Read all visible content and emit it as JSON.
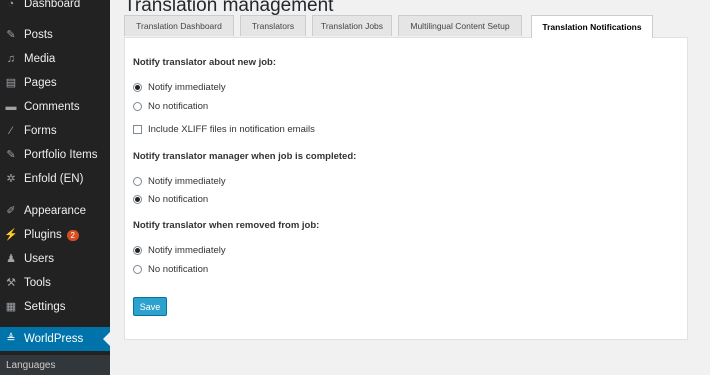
{
  "sidebar": {
    "items": [
      {
        "label": "Dashboard",
        "icon": "dashboard-icon"
      },
      {
        "label": "Posts",
        "icon": "pin-icon"
      },
      {
        "label": "Media",
        "icon": "media-icon"
      },
      {
        "label": "Pages",
        "icon": "pages-icon"
      },
      {
        "label": "Comments",
        "icon": "comments-icon"
      },
      {
        "label": "Forms",
        "icon": "forms-icon"
      },
      {
        "label": "Portfolio Items",
        "icon": "pin-icon"
      },
      {
        "label": "Enfold (EN)",
        "icon": "gear-icon"
      },
      {
        "label": "Appearance",
        "icon": "appearance-icon"
      },
      {
        "label": "Plugins",
        "icon": "plugins-icon",
        "badge": "2"
      },
      {
        "label": "Users",
        "icon": "users-icon"
      },
      {
        "label": "Tools",
        "icon": "tools-icon"
      },
      {
        "label": "Settings",
        "icon": "settings-icon"
      },
      {
        "label": "WorldPress",
        "icon": "worldpress-icon"
      }
    ],
    "submenu": {
      "label": "Languages"
    }
  },
  "main": {
    "title": "Translation management",
    "tabs": [
      {
        "label": "Translation Dashboard"
      },
      {
        "label": "Translators"
      },
      {
        "label": "Translation Jobs"
      },
      {
        "label": "Multilingual Content Setup"
      },
      {
        "label": "Translation Notifications"
      }
    ],
    "active_tab": "Translation Notifications",
    "sections": {
      "new_job": {
        "heading": "Notify translator about new job:",
        "options": [
          {
            "label": "Notify immediately",
            "selected": true
          },
          {
            "label": "No notification",
            "selected": false
          }
        ],
        "checkbox": {
          "label": "Include XLIFF files in notification emails",
          "checked": false
        }
      },
      "job_completed": {
        "heading": "Notify translator manager when job is completed:",
        "options": [
          {
            "label": "Notify immediately",
            "selected": false
          },
          {
            "label": "No notification",
            "selected": true
          }
        ]
      },
      "removed": {
        "heading": "Notify translator when removed from job:",
        "options": [
          {
            "label": "Notify immediately",
            "selected": true
          },
          {
            "label": "No notification",
            "selected": false
          }
        ]
      }
    },
    "save_label": "Save"
  },
  "colors": {
    "accent": "#0073aa",
    "button": "#2ea2cc",
    "sidebar_bg": "#222222",
    "badge": "#d54e21"
  }
}
